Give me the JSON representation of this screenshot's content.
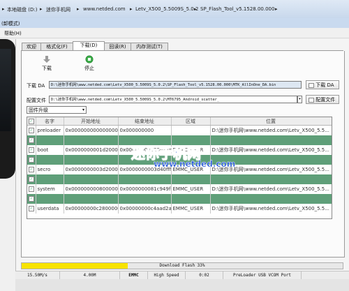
{
  "breadcrumb": [
    "本地磁盘 (D:)",
    "迷你手机网",
    "www.netded.com",
    "Letv_X500_5.5009S_5.0.2",
    "SP_Flash_Tool_v5.1528.00.000"
  ],
  "window": {
    "title_fragment": "(卸模式)"
  },
  "menu": {
    "help": "帮助(H)"
  },
  "tabs": [
    "欢迎",
    "格式化(F)",
    "下载(D)",
    "回读(R)",
    "内存测试(T)"
  ],
  "active_tab": 2,
  "toolbar": {
    "download": "下载",
    "stop": "停止"
  },
  "download_agent": {
    "label": "下载 DA",
    "value": "D:\\迷你手机网\\www.netded.com\\Letv_X500_5.5009S_5.0.2\\SP_Flash_Tool_v5.1528.00.000\\MTK_AllInOne_DA.bin",
    "button": "下载 DA"
  },
  "scatter": {
    "label": "配置文件",
    "value": "D:\\迷你手机网\\www.netded.com\\Letv_X500_5.5009S_5.0.2\\MT6795_Android_scatter_",
    "button": "配置文件"
  },
  "mode": {
    "selected": "固件升级"
  },
  "table": {
    "columns": [
      "",
      "名字",
      "开始地址",
      "结束地址",
      "区域",
      "位置"
    ],
    "rows": [
      {
        "checked": true,
        "name": "preloader",
        "start": "0x0000000000000000",
        "end": "0x000000000",
        "region": "",
        "location": "D:\\迷你手机网\\www.netded.com\\Letv_X500_5.5...",
        "highlight": false
      },
      {
        "checked": true,
        "name": "",
        "start": "",
        "end": "",
        "region": "",
        "location": "",
        "highlight": true
      },
      {
        "checked": true,
        "name": "boot",
        "start": "0x0000000001d20000",
        "end": "0x000000000256a7ff",
        "region": "EMMC_USER",
        "location": "D:\\迷你手机网\\www.netded.com\\Letv_X500_5.5...",
        "highlight": false
      },
      {
        "checked": true,
        "name": "",
        "start": "",
        "end": "",
        "region": "",
        "location": "",
        "highlight": true
      },
      {
        "checked": true,
        "name": "secro",
        "start": "0x0000000003d20000",
        "end": "0x0000000003d40fff",
        "region": "EMMC_USER",
        "location": "D:\\迷你手机网\\www.netded.com\\Letv_X500_5.5...",
        "highlight": false
      },
      {
        "checked": true,
        "name": "",
        "start": "",
        "end": "",
        "region": "",
        "location": "",
        "highlight": true
      },
      {
        "checked": true,
        "name": "system",
        "start": "0x0000000008000000",
        "end": "0x0000000081c949fb",
        "region": "EMMC_USER",
        "location": "D:\\迷你手机网\\www.netded.com\\Letv_X500_5.5...",
        "highlight": false
      },
      {
        "checked": true,
        "name": "",
        "start": "",
        "end": "",
        "region": "",
        "location": "",
        "highlight": true
      },
      {
        "checked": true,
        "name": "userdata",
        "start": "0x00000000c2800000",
        "end": "0x00000000c4aad2a3",
        "region": "EMMC_USER",
        "location": "D:\\迷你手机网\\www.netded.com\\Letv_X500_5.5...",
        "highlight": false
      }
    ]
  },
  "watermark": {
    "line1": "迷你手机网",
    "line2": "www.netded.com"
  },
  "progress": {
    "text": "Download Flash 33%",
    "percent": 33,
    "color": "#f7e300"
  },
  "status": {
    "speed": "15.50M/s",
    "size": "4.00M",
    "storage": "EMMC",
    "speed_mode": "High Speed",
    "time": "0:02",
    "port": "PreLoader USB VCOM Port"
  },
  "colors": {
    "highlight_row": "#5f9f79",
    "watermark": "#1a4fd6"
  }
}
